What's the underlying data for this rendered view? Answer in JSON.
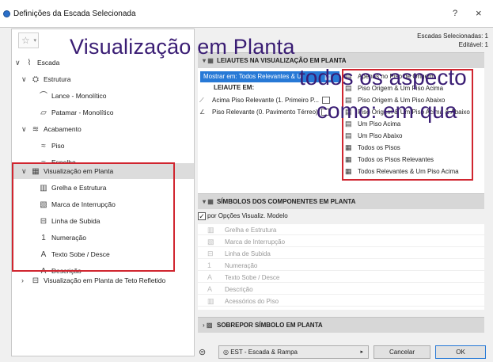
{
  "window": {
    "title": "Definições da Escada Selecionada",
    "help_label": "?",
    "close_label": "×"
  },
  "favorites": {
    "icon": "star-icon",
    "glyph": "☆",
    "caret": "▾"
  },
  "overlay": {
    "title": "Visualização em Planta",
    "line1": "todos os aspecto",
    "line2": "como: em qua"
  },
  "selection_info": {
    "line1": "Escadas Selecionadas: 1",
    "line2": "Editável: 1"
  },
  "tree": [
    {
      "label": "Escada",
      "chev": "∨",
      "icon": "stair-icon"
    },
    {
      "label": "Estrutura",
      "chev": "∨",
      "icon": "structure-icon"
    },
    {
      "label": "Lance - Monolítico",
      "chev": "",
      "icon": "flight-icon"
    },
    {
      "label": "Patamar - Monolítico",
      "chev": "",
      "icon": "landing-icon"
    },
    {
      "label": "Acabamento",
      "chev": "∨",
      "icon": "finish-icon"
    },
    {
      "label": "Piso",
      "chev": "",
      "icon": "tread-icon"
    },
    {
      "label": "Espelho",
      "chev": "",
      "icon": "riser-icon"
    },
    {
      "label": "Visualização em Planta",
      "chev": "∨",
      "icon": "floor-plan-icon"
    },
    {
      "label": "Grelha e Estrutura",
      "chev": "",
      "icon": "grid-icon"
    },
    {
      "label": "Marca de Interrupção",
      "chev": "",
      "icon": "break-mark-icon"
    },
    {
      "label": "Linha de Subida",
      "chev": "",
      "icon": "walking-line-icon"
    },
    {
      "label": "Numeração",
      "chev": "",
      "icon": "numbering-icon"
    },
    {
      "label": "Texto Sobe / Desce",
      "chev": "",
      "icon": "text-icon"
    },
    {
      "label": "Descrição",
      "chev": "",
      "icon": "description-icon"
    },
    {
      "label": "Visualização em Planta de Teto Refletido",
      "chev": "›",
      "icon": "ceiling-plan-icon"
    }
  ],
  "sections": {
    "layouts": "LEIAUTES NA VISUALIZAÇÃO EM PLANTA",
    "symbols": "SÍMBOLOS DOS COMPONENTES EM PLANTA",
    "overlay": "SOBREPOR SÍMBOLO EM PLANTA"
  },
  "layouts": {
    "dropdown": "Mostrar em: Todos Relevantes & U",
    "column_header": "LEIAUTE EM:",
    "rows": [
      {
        "label": "Acima Piso Relevante (1. Primeiro P...",
        "icon": "above-floor-icon"
      },
      {
        "label": "Piso Relevante (0. Pavimento Térreo)",
        "icon": "relevant-floor-icon"
      }
    ]
  },
  "popup_items": [
    {
      "label": "Apenas no Piso de Origem",
      "icon": "home-floor-icon"
    },
    {
      "label": "Piso Origem & Um Piso Acima",
      "icon": "home-and-above-icon"
    },
    {
      "label": "Piso Origem & Um Piso Abaixo",
      "icon": "home-and-below-icon"
    },
    {
      "label": "Piso Origem & Um Piso Acima & Abaixo",
      "icon": "home-above-below-icon"
    },
    {
      "label": "Um Piso Acima",
      "icon": "one-above-icon"
    },
    {
      "label": "Um Piso Abaixo",
      "icon": "one-below-icon"
    },
    {
      "label": "Todos os Pisos",
      "icon": "all-floors-icon"
    },
    {
      "label": "Todos os Pisos Relevantes",
      "icon": "all-relevant-icon"
    },
    {
      "label": "Todos Relevantes & Um Piso Acima",
      "icon": "all-relevant-above-icon"
    }
  ],
  "checkbox": {
    "label": "por Opções Visualiz. Modelo",
    "checked": "✓"
  },
  "symbol_items": [
    {
      "label": "Grelha e Estrutura",
      "icon": "grid-icon"
    },
    {
      "label": "Marca de Interrupção",
      "icon": "break-mark-icon"
    },
    {
      "label": "Linha de Subida",
      "icon": "walking-line-icon"
    },
    {
      "label": "Numeração",
      "icon": "numbering-icon"
    },
    {
      "label": "Texto Sobe / Desce",
      "icon": "text-icon"
    },
    {
      "label": "Descrição",
      "icon": "description-icon"
    },
    {
      "label": "Acessórios do Piso",
      "icon": "tread-accessories-icon"
    }
  ],
  "footer": {
    "favorite_select": "EST - Escada & Rampa",
    "favorite_eye": "◎",
    "cancel": "Cancelar",
    "ok": "OK"
  },
  "colors": {
    "accent": "#2779d6",
    "highlight_box": "#d0252f",
    "overlay_text": "#3a1d74"
  }
}
